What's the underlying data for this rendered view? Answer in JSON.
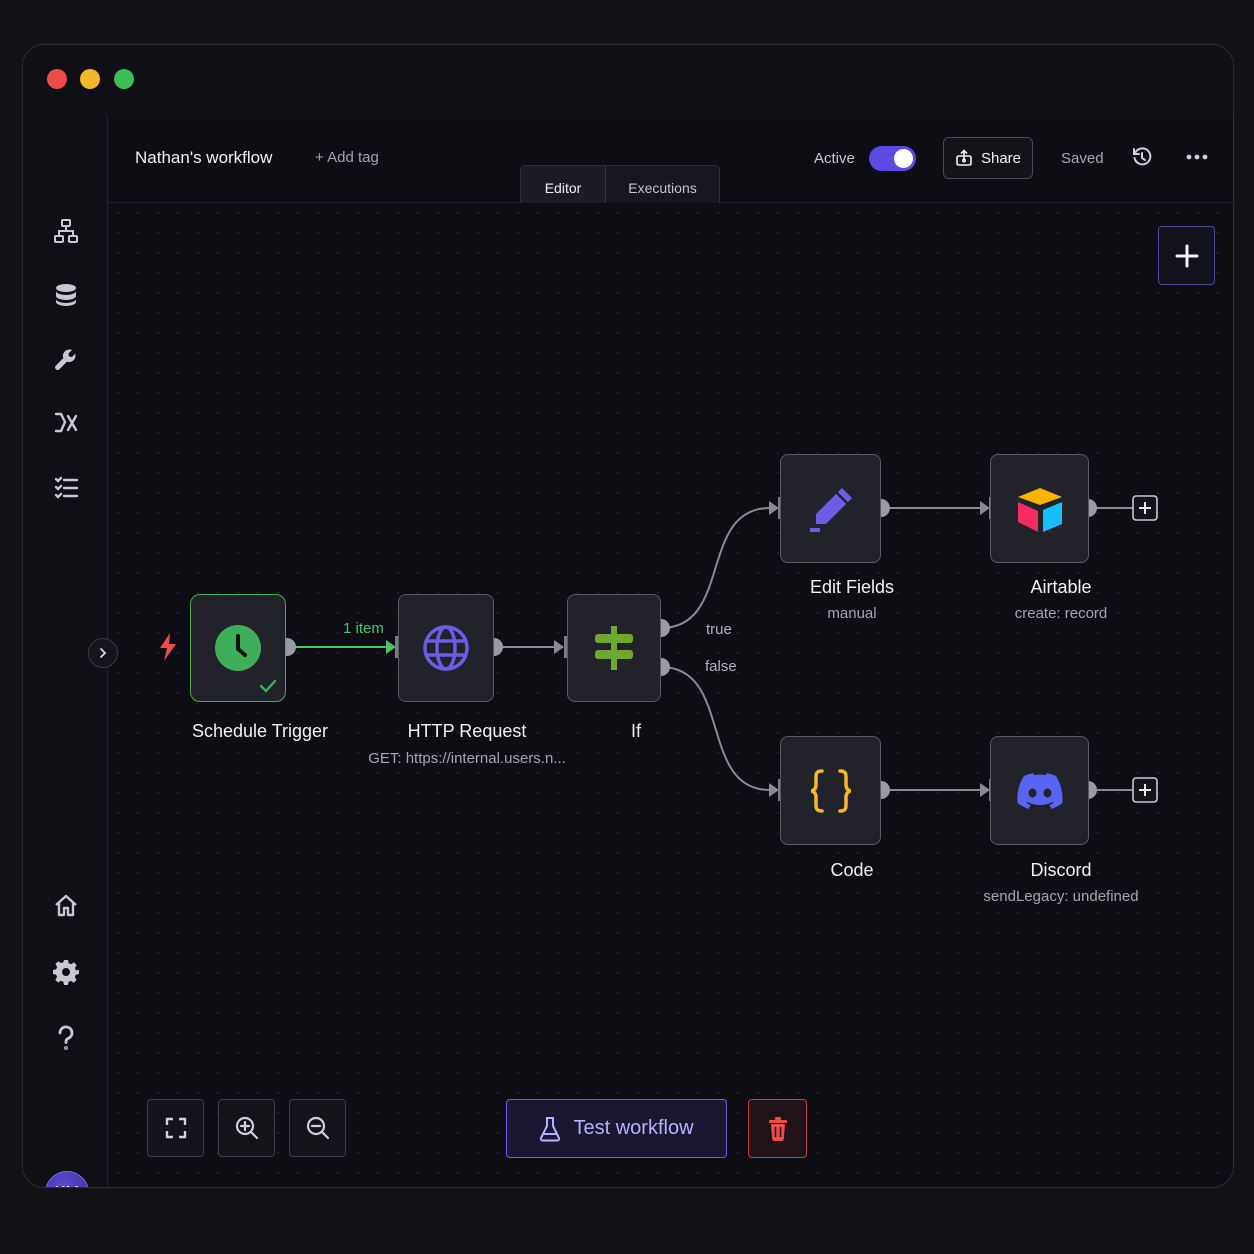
{
  "header": {
    "workflow_name": "Nathan's workflow",
    "add_tag_label": "+ Add tag",
    "tabs": [
      {
        "label": "Editor",
        "active": true
      },
      {
        "label": "Executions",
        "active": false
      }
    ],
    "active_label": "Active",
    "active_toggle_on": true,
    "share_label": "Share",
    "saved_label": "Saved"
  },
  "nodes": {
    "schedule_trigger": {
      "title": "Schedule Trigger",
      "subtitle": "",
      "icon": "clock-icon",
      "status": "success"
    },
    "http_request": {
      "title": "HTTP Request",
      "subtitle": "GET: https://internal.users.n...",
      "icon": "globe-icon"
    },
    "if": {
      "title": "If",
      "subtitle": "",
      "icon": "signpost-icon"
    },
    "edit_fields": {
      "title": "Edit Fields",
      "subtitle": "manual",
      "icon": "pencil-icon"
    },
    "airtable": {
      "title": "Airtable",
      "subtitle": "create: record",
      "icon": "airtable-icon"
    },
    "code": {
      "title": "Code",
      "subtitle": "",
      "icon": "braces-icon"
    },
    "discord": {
      "title": "Discord",
      "subtitle": "sendLegacy: undefined",
      "icon": "discord-icon"
    }
  },
  "edges": {
    "trigger_to_http_label": "1 item",
    "if_true_label": "true",
    "if_false_label": "false"
  },
  "footer": {
    "test_workflow_label": "Test workflow"
  },
  "user": {
    "initials": "KM"
  },
  "colors": {
    "accent": "#5b4be0",
    "success": "#3fae5a",
    "danger": "#c23a40",
    "code_yellow": "#f5b82a"
  }
}
